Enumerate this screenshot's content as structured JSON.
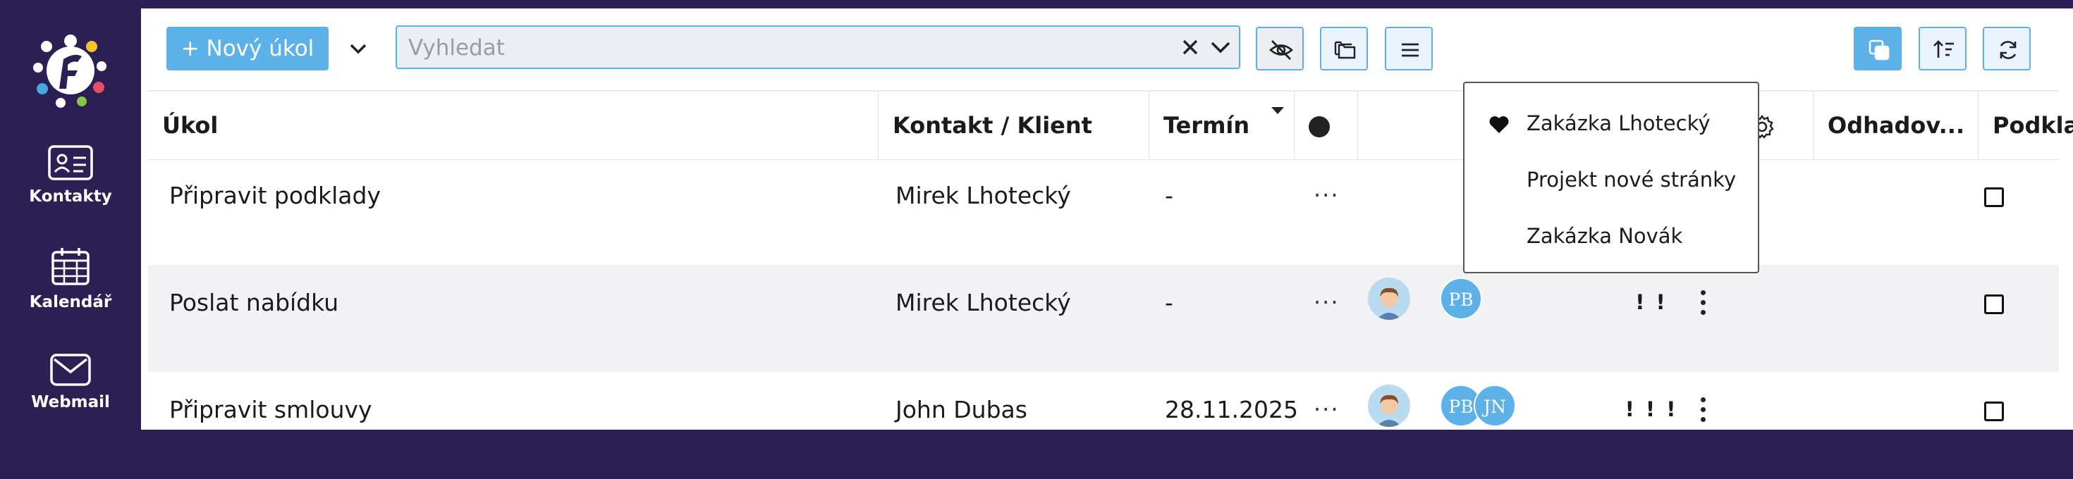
{
  "sidebar": {
    "items": [
      {
        "label": "Kontakty",
        "icon": "contact-card-icon"
      },
      {
        "label": "Kalendář",
        "icon": "calendar-icon"
      },
      {
        "label": "Webmail",
        "icon": "mail-icon"
      }
    ]
  },
  "toolbar": {
    "new_task_label": "+ Nový úkol",
    "search_placeholder": "Vyhledat",
    "search_value": ""
  },
  "table": {
    "columns": [
      "Úkol",
      "Kontakt / Klient",
      "Termín",
      "Odhadov...",
      "Podklady"
    ],
    "rows": [
      {
        "task": "Připravit podklady",
        "contact": "Mirek Lhotecký",
        "deadline": "-",
        "more": "···",
        "priority": "!",
        "initials": [],
        "has_avatar": false,
        "checked": false
      },
      {
        "task": "Poslat nabídku",
        "contact": "Mirek Lhotecký",
        "deadline": "-",
        "more": "···",
        "priority": "! !",
        "initials": [
          "PB"
        ],
        "has_avatar": true,
        "checked": false
      },
      {
        "task": "Připravit smlouvy",
        "contact": "John Dubas",
        "deadline": "28.11.2025",
        "more": "···",
        "priority": "! ! !",
        "initials": [
          "PB",
          "JN"
        ],
        "has_avatar": true,
        "checked": false
      }
    ]
  },
  "dropdown": {
    "items": [
      "Zakázka Lhotecký",
      "Projekt nové stránky",
      "Zakázka Novák"
    ],
    "favorite_index": 0
  },
  "colors": {
    "sidebar_bg": "#2b1f54",
    "accent": "#5cb2e8",
    "row_alt": "#f2f2f4"
  }
}
